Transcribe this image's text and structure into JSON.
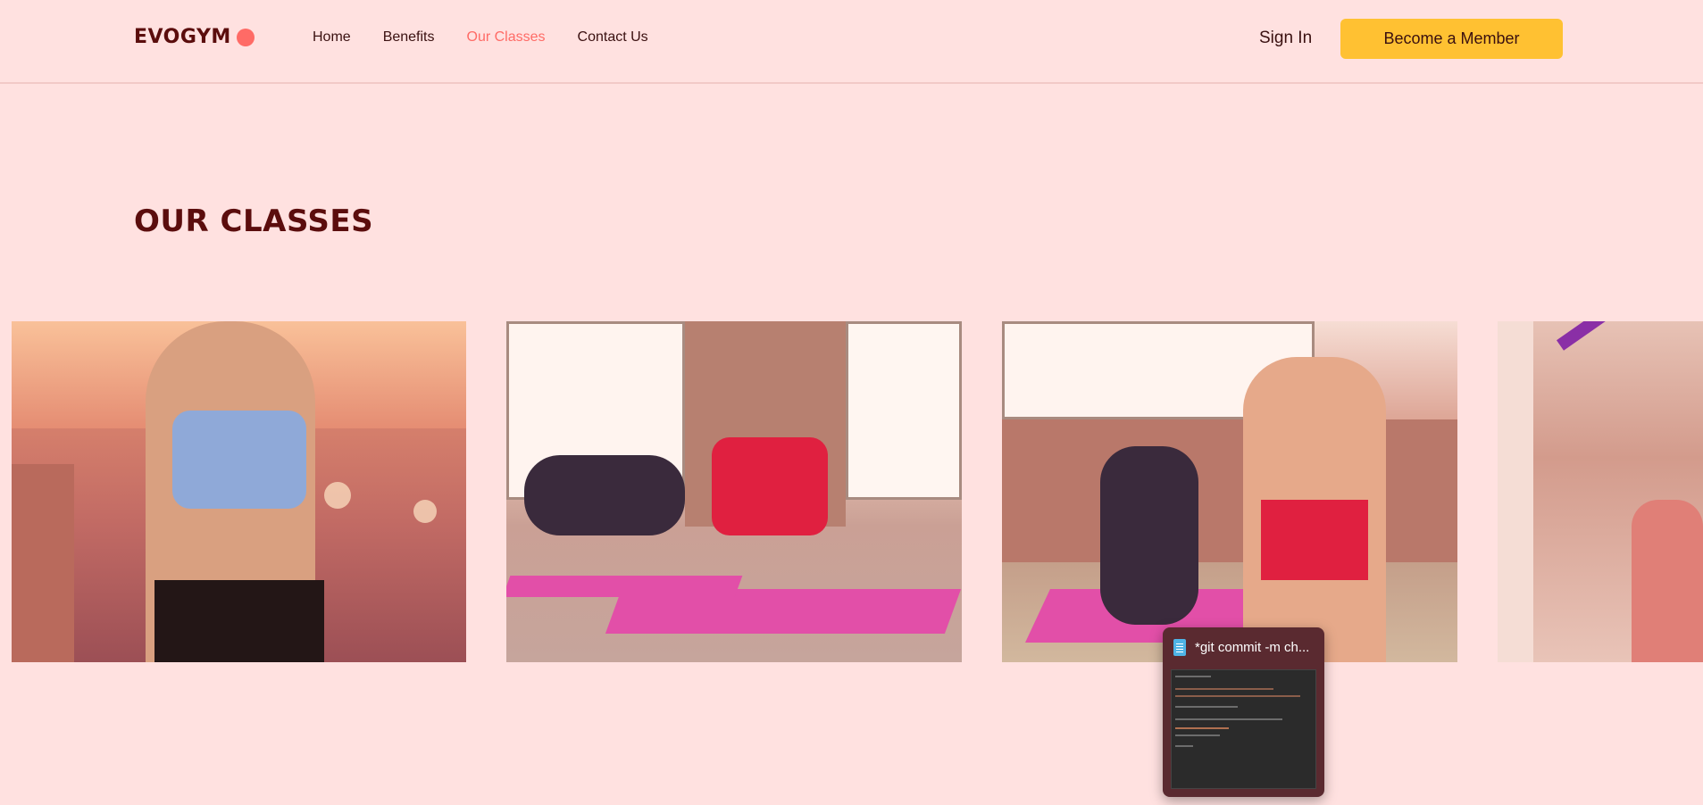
{
  "navbar": {
    "logo_text": "EVOGYM",
    "links": [
      {
        "label": "Home",
        "active": false
      },
      {
        "label": "Benefits",
        "active": false
      },
      {
        "label": "Our Classes",
        "active": true
      },
      {
        "label": "Contact Us",
        "active": false
      }
    ],
    "sign_in": "Sign In",
    "member_button": "Become a Member"
  },
  "section": {
    "title": "OUR CLASSES"
  },
  "colors": {
    "background": "#ffe1e0",
    "brand_dark": "#5b0d0d",
    "accent_coral": "#ff6b66",
    "accent_yellow": "#ffc132"
  },
  "taskbar_preview": {
    "title": "*git commit -m ch...",
    "icon": "notepad-icon"
  }
}
